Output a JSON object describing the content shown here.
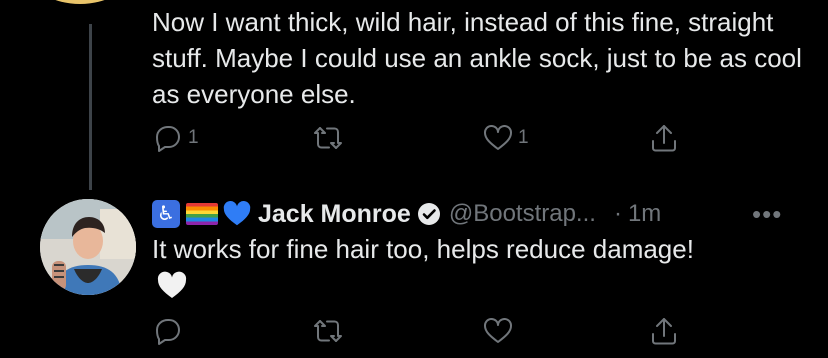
{
  "tweet1": {
    "text": "Now I want thick, wild hair, instead of this fine, straight stuff. Maybe I could use an ankle sock, just to be as cool as everyone else.",
    "reply_count": "1",
    "retweet_count": "",
    "like_count": "1"
  },
  "tweet2": {
    "name": "Jack Monroe",
    "handle": "@Bootstrap...",
    "dot": "·",
    "time": "1m",
    "more": "•••",
    "text": "It works for fine hair too, helps reduce damage!",
    "badges": [
      "wheelchair-emoji",
      "rainbow-flag-emoji",
      "blue-heart-emoji"
    ],
    "trailing_emoji": "white-heart-emoji"
  },
  "colors": {
    "background": "#000000",
    "text": "#e7e9ea",
    "muted": "#71767b",
    "thread_line": "#3d4349"
  }
}
